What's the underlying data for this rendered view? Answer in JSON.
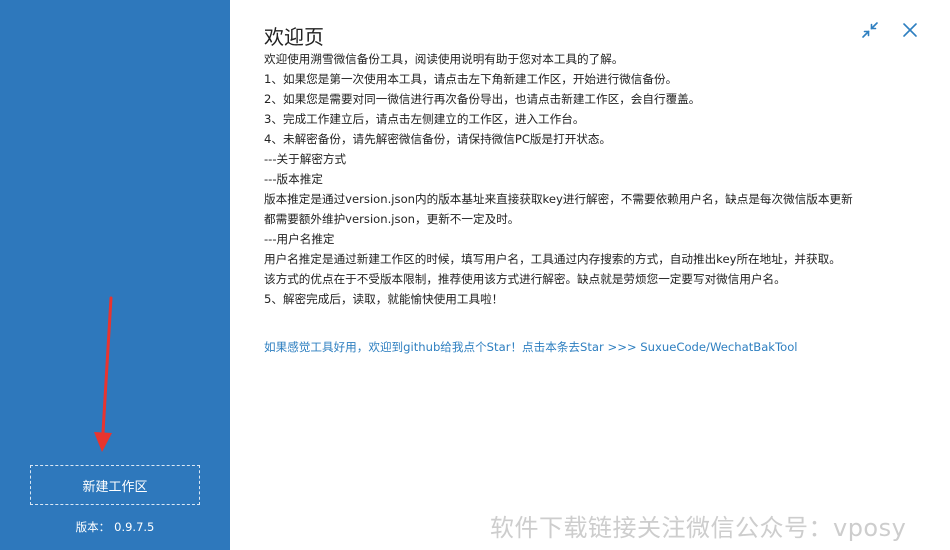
{
  "sidebar": {
    "new_workspace_button": "新建工作区",
    "version_label": "版本：",
    "version_value": "0.9.7.5",
    "bg_color": "#2e78bc",
    "arrow_color": "#e8342f"
  },
  "main": {
    "title": "欢迎页",
    "lines": [
      "欢迎使用溯雪微信备份工具，阅读使用说明有助于您对本工具的了解。",
      "1、如果您是第一次使用本工具，请点击左下角新建工作区，开始进行微信备份。",
      "2、如果您是需要对同一微信进行再次备份导出，也请点击新建工作区，会自行覆盖。",
      "3、完成工作建立后，请点击左侧建立的工作区，进入工作台。",
      "4、未解密备份，请先解密微信备份，请保持微信PC版是打开状态。",
      "---关于解密方式",
      "---版本推定",
      "版本推定是通过version.json内的版本基址来直接获取key进行解密，不需要依赖用户名，缺点是每次微信版本更新",
      "都需要额外维护version.json，更新不一定及时。",
      "---用户名推定",
      "用户名推定是通过新建工作区的时候，填写用户名，工具通过内存搜索的方式，自动推出key所在地址，并获取。",
      "该方式的优点在于不受版本限制，推荐使用该方式进行解密。缺点就是劳烦您一定要写对微信用户名。",
      "5、解密完成后，读取，就能愉快使用工具啦！"
    ],
    "github_link": "如果感觉工具好用，欢迎到github给我点个Star！点击本条去Star  >>>  SuxueCode/WechatBakTool",
    "link_color": "#2e7fc0"
  },
  "window": {
    "shrink_icon": "shrink-icon",
    "close_icon": "close-icon",
    "icon_color": "#2e7fc0"
  },
  "watermark": "软件下载链接关注微信公众号：vposy"
}
